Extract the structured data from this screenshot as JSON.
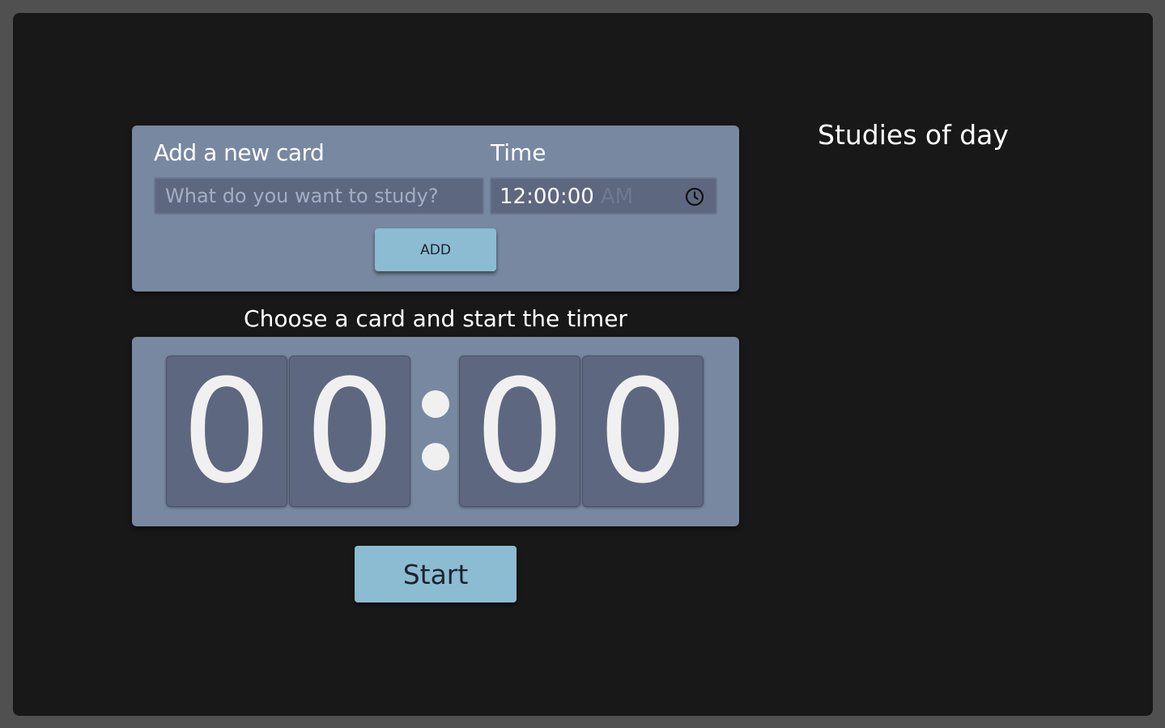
{
  "new_card": {
    "label": "Add a new card",
    "placeholder": "What do you want to study?",
    "value": "",
    "time_label": "Time",
    "time_value": "12:00:00",
    "time_ampm": "AM",
    "add_label": "ADD"
  },
  "timer": {
    "instruction": "Choose a card and start the timer",
    "digits": [
      "0",
      "0",
      "0",
      "0"
    ],
    "start_label": "Start"
  },
  "studies": {
    "title": "Studies of day",
    "items": []
  },
  "colors": {
    "page_background": "#181818",
    "panel": "#7888a0",
    "digit_tile": "#5e6780",
    "button": "#8bbcd1",
    "frame": "#505050"
  },
  "icons": {
    "time_picker": "clock-icon"
  }
}
